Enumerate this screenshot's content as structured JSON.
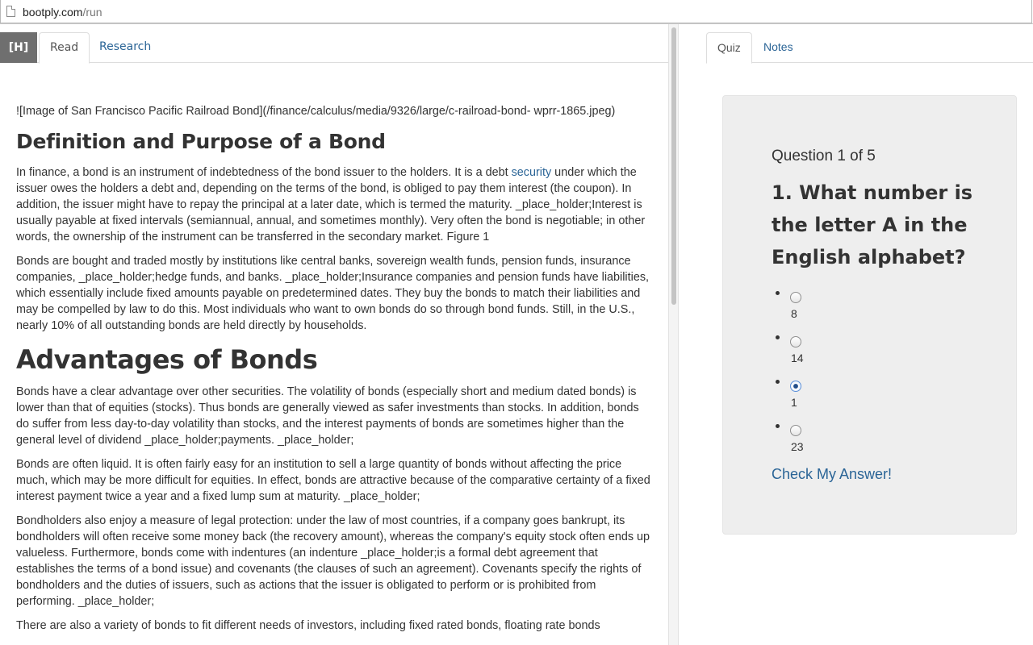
{
  "browser": {
    "url_domain": "bootply.com",
    "url_path": "/run"
  },
  "left_tabs": {
    "home_label": "[H]",
    "read_label": "Read",
    "research_label": "Research"
  },
  "article": {
    "image_markdown": "![Image of San Francisco Pacific Railroad Bond](/finance/calculus/media/9326/large/c-railroad-bond- wprr-1865.jpeg)",
    "heading_1": "Definition and Purpose of a Bond",
    "p1_before_link": "In finance, a bond is an instrument of indebtedness of the bond issuer to the holders. It is a debt ",
    "p1_link": "security",
    "p1_after_link": " under which the issuer owes the holders a debt and, depending on the terms of the bond, is obliged to pay them interest (the coupon). In addition, the issuer might have to repay the principal at a later date, which is termed the maturity. _place_holder;Interest is usually payable at fixed intervals (semiannual, annual, and sometimes monthly). Very often the bond is negotiable; in other words, the ownership of the instrument can be transferred in the secondary market. Figure 1",
    "p2": "Bonds are bought and traded mostly by institutions like central banks, sovereign wealth funds, pension funds, insurance companies, _place_holder;hedge funds, and banks. _place_holder;Insurance companies and pension funds have liabilities, which essentially include fixed amounts payable on predetermined dates. They buy the bonds to match their liabilities and may be compelled by law to do this. Most individuals who want to own bonds do so through bond funds. Still, in the U.S., nearly 10% of all outstanding bonds are held directly by households.",
    "heading_2": "Advantages of Bonds",
    "p3": "Bonds have a clear advantage over other securities. The volatility of bonds (especially short and medium dated bonds) is lower than that of equities (stocks). Thus bonds are generally viewed as safer investments than stocks. In addition, bonds do suffer from less day-to-day volatility than stocks, and the interest payments of bonds are sometimes higher than the general level of dividend _place_holder;payments. _place_holder;",
    "p4": "Bonds are often liquid. It is often fairly easy for an institution to sell a large quantity of bonds without affecting the price much, which may be more difficult for equities. In effect, bonds are attractive because of the comparative certainty of a fixed interest payment twice a year and a fixed lump sum at maturity. _place_holder;",
    "p5": "Bondholders also enjoy a measure of legal protection: under the law of most countries, if a company goes bankrupt, its bondholders will often receive some money back (the recovery amount), whereas the company's equity stock often ends up valueless. Furthermore, bonds come with indentures (an indenture _place_holder;is a formal debt agreement that establishes the terms of a bond issue) and covenants (the clauses of such an agreement). Covenants specify the rights of bondholders and the duties of issuers, such as actions that the issuer is obligated to perform or is prohibited from performing. _place_holder;",
    "p6": "There are also a variety of bonds to fit different needs of investors, including fixed rated bonds, floating rate bonds"
  },
  "right_tabs": {
    "quiz_label": "Quiz",
    "notes_label": "Notes"
  },
  "quiz": {
    "counter": "Question 1 of 5",
    "question": "1. What number is the letter A in the English alphabet?",
    "options": [
      {
        "label": "8",
        "selected": false
      },
      {
        "label": "14",
        "selected": false
      },
      {
        "label": "1",
        "selected": true
      },
      {
        "label": "23",
        "selected": false
      }
    ],
    "check_label": "Check My Answer!"
  },
  "colors": {
    "link": "#2a6496",
    "home_tab_bg": "#6f6f6f",
    "quiz_panel_bg": "#eeeeee"
  }
}
